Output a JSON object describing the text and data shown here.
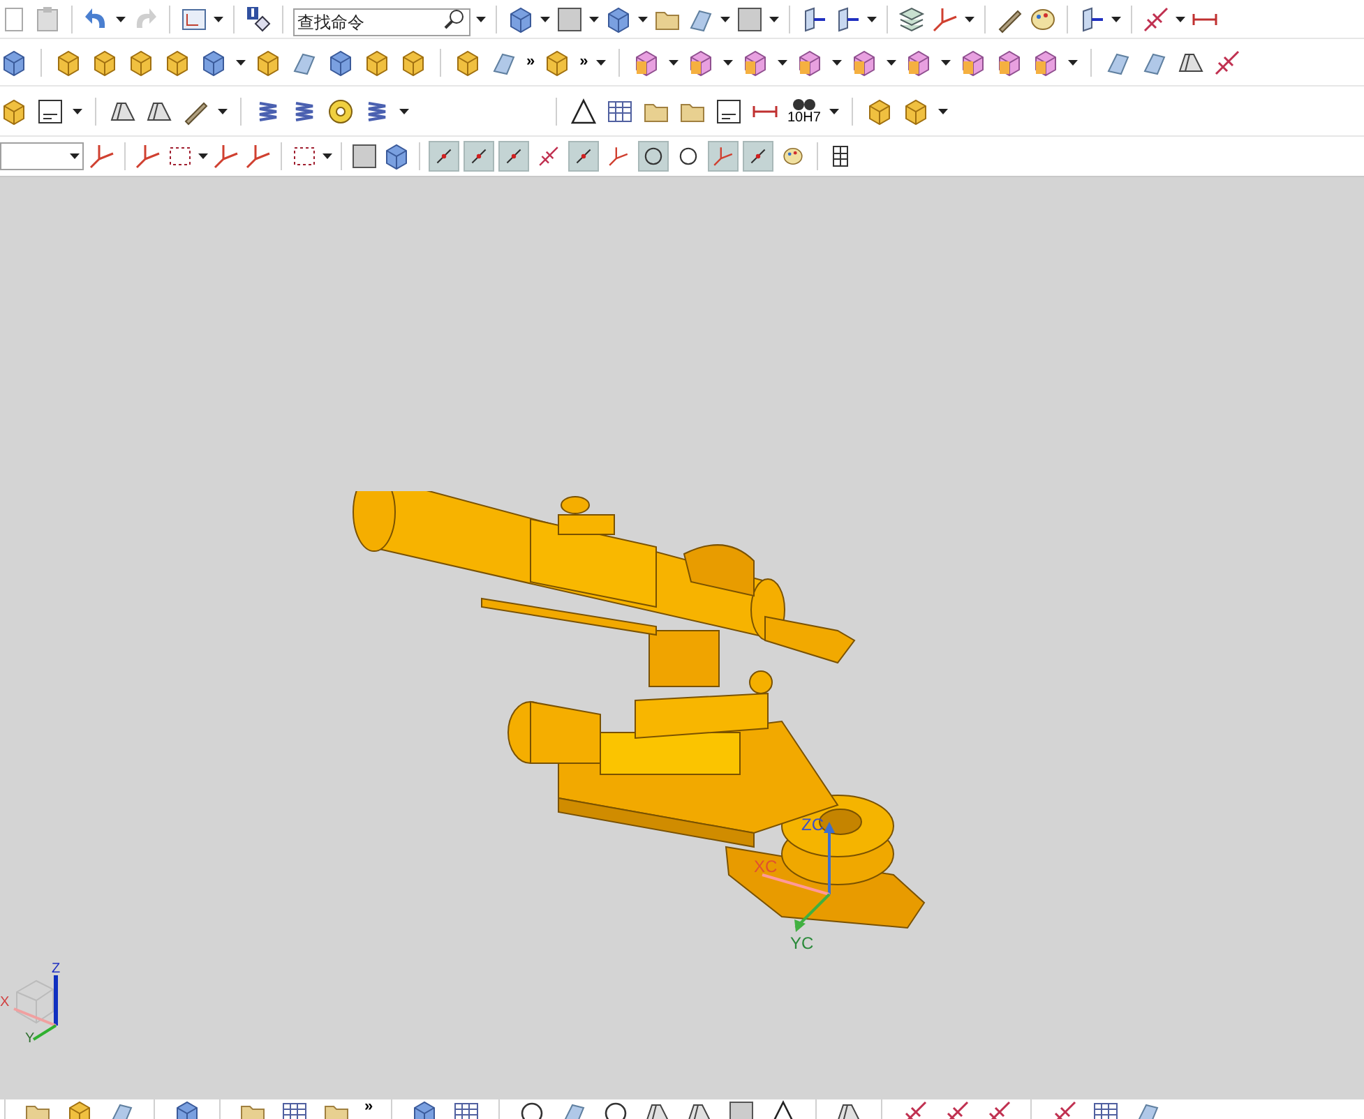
{
  "search": {
    "placeholder": "查找命令"
  },
  "toolbar_overflow": [
    "»",
    "»",
    "»"
  ],
  "fit_button": {
    "label": "10H7"
  },
  "snap_toggles": [
    {
      "selected": true
    },
    {
      "selected": true
    },
    {
      "selected": true
    },
    {
      "selected": false
    },
    {
      "selected": true
    },
    {
      "selected": false
    },
    {
      "selected": true
    },
    {
      "selected": false
    },
    {
      "selected": true
    },
    {
      "selected": true
    },
    {
      "selected": false
    }
  ],
  "model_triad": {
    "z": "ZC",
    "x": "XC",
    "y": "YC"
  },
  "view_triad": {
    "x": "X",
    "y": "Y",
    "z": "Z"
  }
}
